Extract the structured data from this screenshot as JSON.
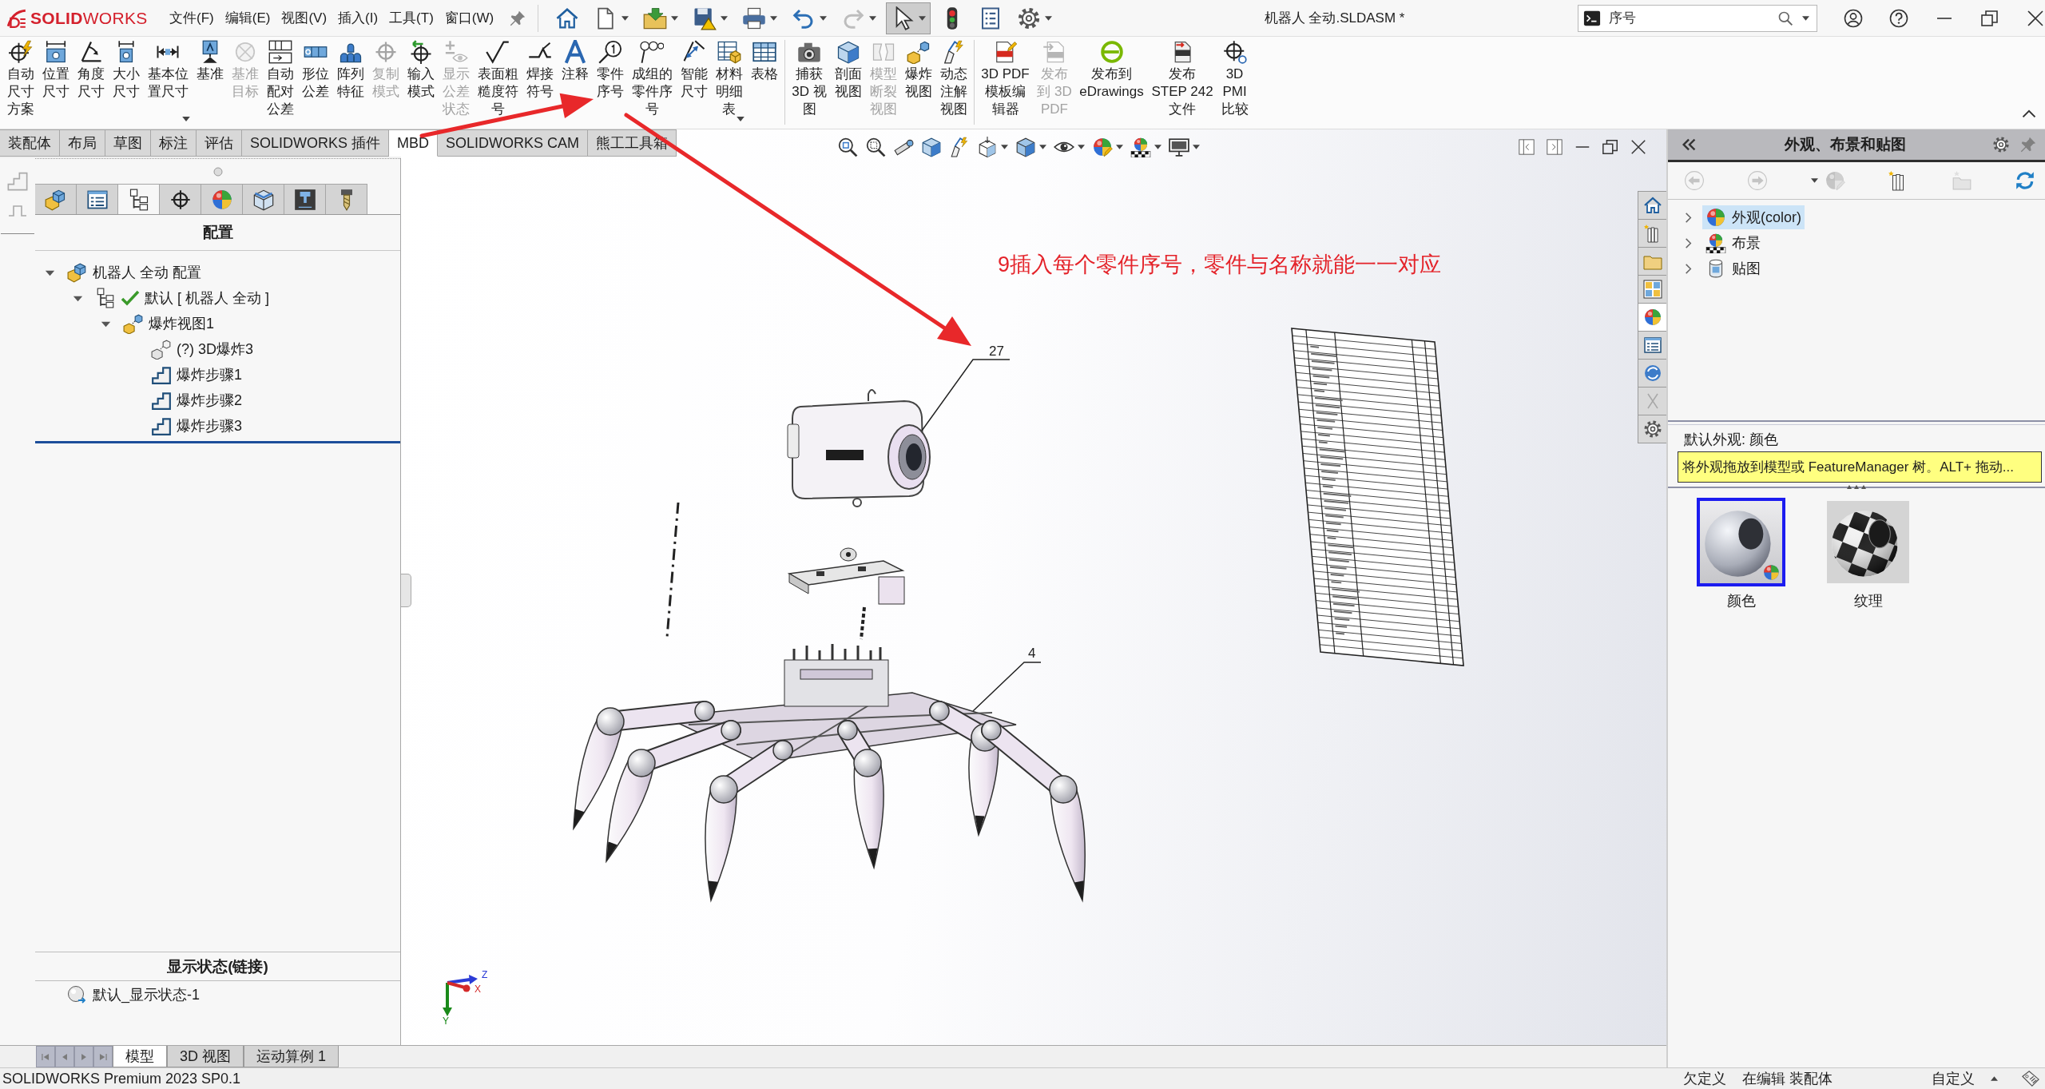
{
  "app_bar": {
    "logo": "**SOLID**WORKS",
    "menu": [
      "文件(F)",
      "编辑(E)",
      "视图(V)",
      "插入(I)",
      "工具(T)",
      "窗口(W)"
    ],
    "quick_access": [
      {
        "selected": false,
        "disabled": false
      },
      {
        "selected": false,
        "disabled": false
      },
      {
        "selected": false,
        "disabled": false
      },
      {
        "selected": false,
        "disabled": false
      },
      {
        "selected": false,
        "disabled": false
      },
      {
        "selected": false,
        "disabled": false
      },
      {
        "selected": false,
        "disabled": true
      },
      {
        "selected": true,
        "disabled": false
      },
      {
        "selected": false,
        "disabled": false
      },
      {
        "selected": false,
        "disabled": false
      },
      {
        "selected": false,
        "disabled": false
      }
    ],
    "title": "机器人 全动.SLDASM *",
    "search": {
      "value": "序号"
    }
  },
  "command_manager": {
    "groups": [
      [
        {
          "label": "自动尺寸方案",
          "disabled": false,
          "dropdown": false
        },
        {
          "label": "位置尺寸",
          "disabled": false,
          "dropdown": false
        },
        {
          "label": "角度尺寸",
          "disabled": false,
          "dropdown": false
        },
        {
          "label": "大小尺寸",
          "disabled": false,
          "dropdown": false
        },
        {
          "label": "基本位置尺寸",
          "disabled": false,
          "dropdown": true
        },
        {
          "label": "基准",
          "disabled": false,
          "dropdown": false
        },
        {
          "label": "基准目标",
          "disabled": true,
          "dropdown": false
        },
        {
          "label": "自动配对公差",
          "disabled": false,
          "dropdown": false
        },
        {
          "label": "形位公差",
          "disabled": false,
          "dropdown": false
        },
        {
          "label": "阵列特征",
          "disabled": false,
          "dropdown": false
        },
        {
          "label": "复制模式",
          "disabled": true,
          "dropdown": false
        },
        {
          "label": "输入模式",
          "disabled": false,
          "dropdown": false
        },
        {
          "label": "显示公差状态",
          "disabled": true,
          "dropdown": false
        },
        {
          "label": "表面粗糙度符号",
          "disabled": false,
          "dropdown": false
        },
        {
          "label": "焊接符号",
          "disabled": false,
          "dropdown": false
        },
        {
          "label": "注释",
          "disabled": false,
          "dropdown": false
        },
        {
          "label": "零件序号",
          "disabled": false,
          "dropdown": false
        },
        {
          "label": "成组的零件序号",
          "disabled": false,
          "dropdown": false
        },
        {
          "label": "智能尺寸",
          "disabled": false,
          "dropdown": false
        },
        {
          "label": "材料明细表",
          "disabled": false,
          "dropdown": true
        },
        {
          "label": "表格",
          "disabled": false,
          "dropdown": false
        }
      ],
      [
        {
          "label": "捕获3D 视图",
          "disabled": false,
          "dropdown": false
        },
        {
          "label": "剖面视图",
          "disabled": false,
          "dropdown": false
        },
        {
          "label": "模型断裂视图",
          "disabled": true,
          "dropdown": false
        },
        {
          "label": "爆炸视图",
          "disabled": false,
          "dropdown": false
        },
        {
          "label": "动态注解视图",
          "disabled": false,
          "dropdown": false
        }
      ],
      [
        {
          "label": "3D PDF模板编辑器",
          "disabled": false,
          "dropdown": false
        },
        {
          "label": "发布到 3D PDF",
          "disabled": true,
          "dropdown": false
        },
        {
          "label": "发布到eDrawings",
          "disabled": false,
          "dropdown": false
        },
        {
          "label": "发布STEP 242文件",
          "disabled": false,
          "dropdown": false
        },
        {
          "label": "3D PMI比较",
          "disabled": false,
          "dropdown": false
        }
      ]
    ]
  },
  "command_tabs": [
    {
      "label": "装配体",
      "selected": false
    },
    {
      "label": "布局",
      "selected": false
    },
    {
      "label": "草图",
      "selected": false
    },
    {
      "label": "标注",
      "selected": false
    },
    {
      "label": "评估",
      "selected": false
    },
    {
      "label": "SOLIDWORKS 插件",
      "selected": false
    },
    {
      "label": "MBD",
      "selected": true
    },
    {
      "label": "SOLIDWORKS CAM",
      "selected": false
    },
    {
      "label": "熊工工具箱",
      "selected": false
    }
  ],
  "left_panel": {
    "tabs": [
      {
        "selected": false
      },
      {
        "selected": false
      },
      {
        "selected": true
      },
      {
        "selected": false
      },
      {
        "selected": false
      },
      {
        "selected": false
      },
      {
        "selected": false
      },
      {
        "selected": false
      }
    ],
    "heading": "配置",
    "tree": [
      {
        "kind": "assembly",
        "label": "机器人 全动 配置",
        "expanded": true,
        "active": false,
        "children": [
          {
            "kind": "configuration",
            "label": "默认 [ 机器人 全动 ]",
            "expanded": true,
            "active": true,
            "children": [
              {
                "kind": "exploded-view",
                "label": "爆炸视图1",
                "expanded": true,
                "active": false,
                "children": [
                  {
                    "kind": "explode",
                    "label": "(?) 3D爆炸3",
                    "active": false
                  },
                  {
                    "kind": "step",
                    "label": "爆炸步骤1",
                    "active": false
                  },
                  {
                    "kind": "step",
                    "label": "爆炸步骤2",
                    "active": false
                  },
                  {
                    "kind": "step",
                    "label": "爆炸步骤3",
                    "active": false
                  }
                ]
              }
            ]
          }
        ]
      }
    ],
    "display_states": {
      "heading": "显示状态(链接)",
      "items": [
        "默认_显示状态-1"
      ]
    }
  },
  "bottom_tabs": [
    {
      "label": "模型",
      "selected": true
    },
    {
      "label": "3D 视图",
      "selected": false
    },
    {
      "label": "运动算例 1",
      "selected": false
    }
  ],
  "viewport": {
    "annotation": "9插入每个零件序号，零件与名称就能一一对应",
    "balloons": [
      "27",
      "4"
    ],
    "triad": [
      "Z",
      "X",
      "Y"
    ],
    "task_pane_tabs": [
      {
        "selected": false
      },
      {
        "selected": false
      },
      {
        "selected": false
      },
      {
        "selected": false
      },
      {
        "selected": true
      },
      {
        "selected": false
      },
      {
        "selected": false
      },
      {
        "selected": false
      },
      {
        "selected": false
      }
    ]
  },
  "task_pane": {
    "title": "外观、布景和贴图",
    "tools": [
      {
        "disabled": true
      },
      {
        "disabled": true
      },
      {
        "disabled": true
      },
      {
        "disabled": false
      },
      {
        "disabled": true
      },
      {
        "disabled": false
      }
    ],
    "tree": [
      {
        "label": "外观(color)",
        "selected": true,
        "expanded": false
      },
      {
        "label": "布景",
        "selected": false,
        "expanded": false
      },
      {
        "label": "贴图",
        "selected": false,
        "expanded": false
      }
    ],
    "current": "默认外观: 颜色",
    "tooltip": "将外观拖放到模型或 FeatureManager 树。ALT+ 拖动...",
    "swatches": [
      {
        "label": "颜色",
        "selected": true
      },
      {
        "label": "纹理",
        "selected": false
      }
    ]
  },
  "status_bar": {
    "version": "SOLIDWORKS Premium 2023 SP0.1",
    "items": [
      "欠定义",
      "在编辑 装配体",
      "自定义"
    ]
  }
}
